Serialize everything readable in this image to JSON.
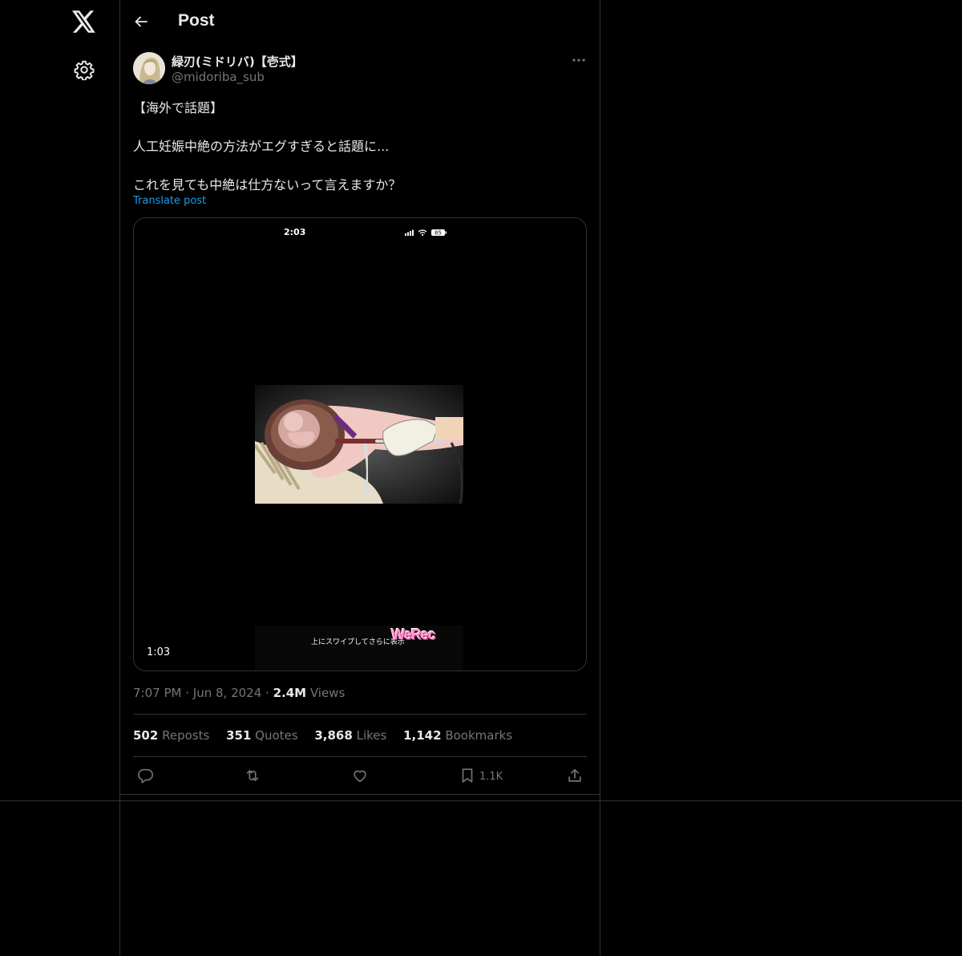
{
  "nav": {
    "logo_icon": "x-logo-icon",
    "settings_icon": "gear-icon"
  },
  "header": {
    "title": "Post"
  },
  "post": {
    "author_name": "緑刃(ミドリバ)【壱式】",
    "author_handle": "@midoriba_sub",
    "text_lines": [
      "【海外で話題】",
      "人工妊娠中絶の方法がエグすぎると話題に...",
      "これを見ても中絶は仕方ないって言えますか？"
    ],
    "translate_label": "Translate post",
    "media": {
      "phone_time": "2:03",
      "battery": "85",
      "caption": "上にスワイプしてさらに表示",
      "watermark": "WeRec",
      "duration": "1:03"
    },
    "time": "7:07 PM",
    "date": "Jun 8, 2024",
    "views_count": "2.4M",
    "views_label": "Views",
    "stats": {
      "reposts_count": "502",
      "reposts_label": "Reposts",
      "quotes_count": "351",
      "quotes_label": "Quotes",
      "likes_count": "3,868",
      "likes_label": "Likes",
      "bookmarks_count": "1,142",
      "bookmarks_label": "Bookmarks"
    },
    "actions": {
      "reply_icon": "reply-icon",
      "repost_icon": "repost-icon",
      "like_icon": "heart-icon",
      "bookmark_icon": "bookmark-icon",
      "bookmark_count": "1.1K",
      "share_icon": "share-icon"
    }
  },
  "colors": {
    "background": "#000000",
    "text": "#e7e9ea",
    "secondary": "#71767b",
    "accent": "#1d9bf0",
    "border": "#2f3336"
  }
}
